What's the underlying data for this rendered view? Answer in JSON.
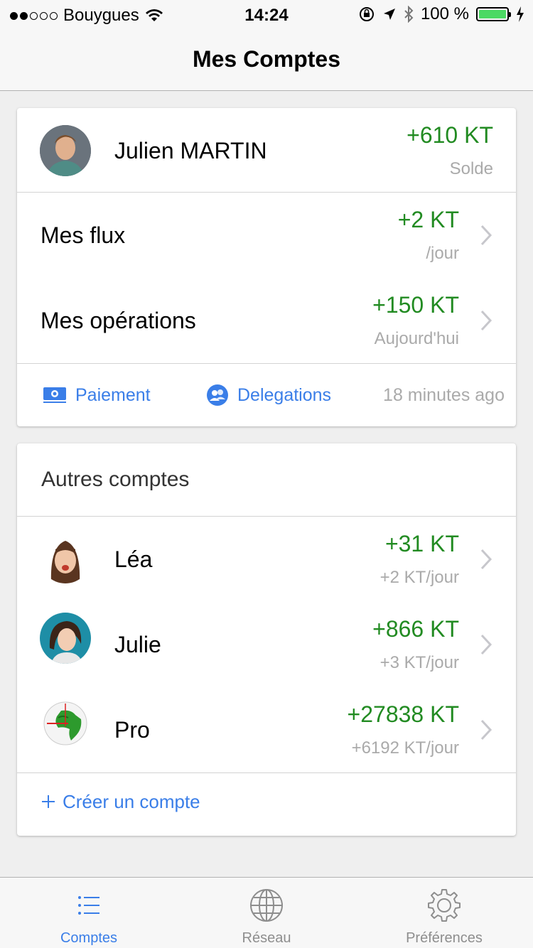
{
  "status_bar": {
    "carrier": "Bouygues",
    "time": "14:24",
    "battery": "100 %",
    "battery_color": "#4cd964"
  },
  "nav": {
    "title": "Mes Comptes"
  },
  "main_account": {
    "name": "Julien MARTIN",
    "amount": "+610 KT",
    "amount_sub": "Solde",
    "rows": [
      {
        "label": "Mes flux",
        "amount": "+2 KT",
        "sub": "/jour"
      },
      {
        "label": "Mes opérations",
        "amount": "+150 KT",
        "sub": "Aujourd'hui"
      }
    ],
    "actions": {
      "payment": "Paiement",
      "delegations": "Delegations",
      "updated": "18 minutes ago"
    }
  },
  "other_accounts": {
    "title": "Autres comptes",
    "items": [
      {
        "name": "Léa",
        "amount": "+31 KT",
        "sub": "+2 KT/jour"
      },
      {
        "name": "Julie",
        "amount": "+866 KT",
        "sub": "+3 KT/jour"
      },
      {
        "name": "Pro",
        "amount": "+27838 KT",
        "sub": "+6192 KT/jour"
      }
    ],
    "create": "Créer un compte"
  },
  "tabs": [
    {
      "label": "Comptes",
      "icon": "list-icon",
      "active": true
    },
    {
      "label": "Réseau",
      "icon": "globe-icon",
      "active": false
    },
    {
      "label": "Préférences",
      "icon": "gear-icon",
      "active": false
    }
  ],
  "colors": {
    "positive": "#228b22",
    "accent": "#3a7ee8",
    "secondary_text": "#aaaaaa"
  }
}
